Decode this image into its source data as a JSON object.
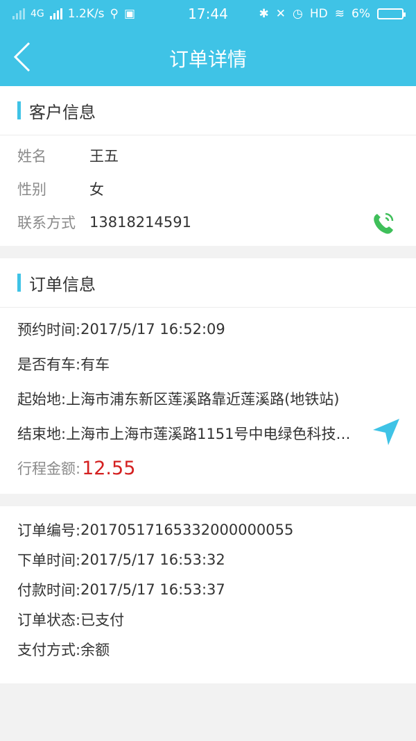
{
  "status": {
    "network": "4G",
    "speed": "1.2K/s",
    "time": "17:44",
    "hd": "HD",
    "battery": "6%"
  },
  "header": {
    "title": "订单详情"
  },
  "customer": {
    "section_title": "客户信息",
    "name_label": "姓名",
    "name": "王五",
    "gender_label": "性别",
    "gender": "女",
    "contact_label": "联系方式",
    "phone": "13818214591"
  },
  "order": {
    "section_title": "订单信息",
    "appointment_label": "预约时间: ",
    "appointment": "2017/5/17 16:52:09",
    "hascar_label": "是否有车: ",
    "hascar": "有车",
    "start_label": "起始地: ",
    "start": "上海市浦东新区莲溪路靠近莲溪路(地铁站)",
    "end_label": "结束地: ",
    "end": "上海市上海市莲溪路1151号中电绿色科技…",
    "fare_label": "行程金额:",
    "fare": "12.55"
  },
  "meta": {
    "order_no_label": "订单编号: ",
    "order_no": "20170517165332000000055",
    "order_time_label": "下单时间: ",
    "order_time": "2017/5/17 16:53:32",
    "pay_time_label": "付款时间: ",
    "pay_time": "2017/5/17 16:53:37",
    "state_label": "订单状态: ",
    "state": "已支付",
    "pay_method_label": "支付方式: ",
    "pay_method": "余额"
  },
  "colors": {
    "accent": "#3fc3e6",
    "phone": "#3fbf5a",
    "fare": "#d42020"
  }
}
